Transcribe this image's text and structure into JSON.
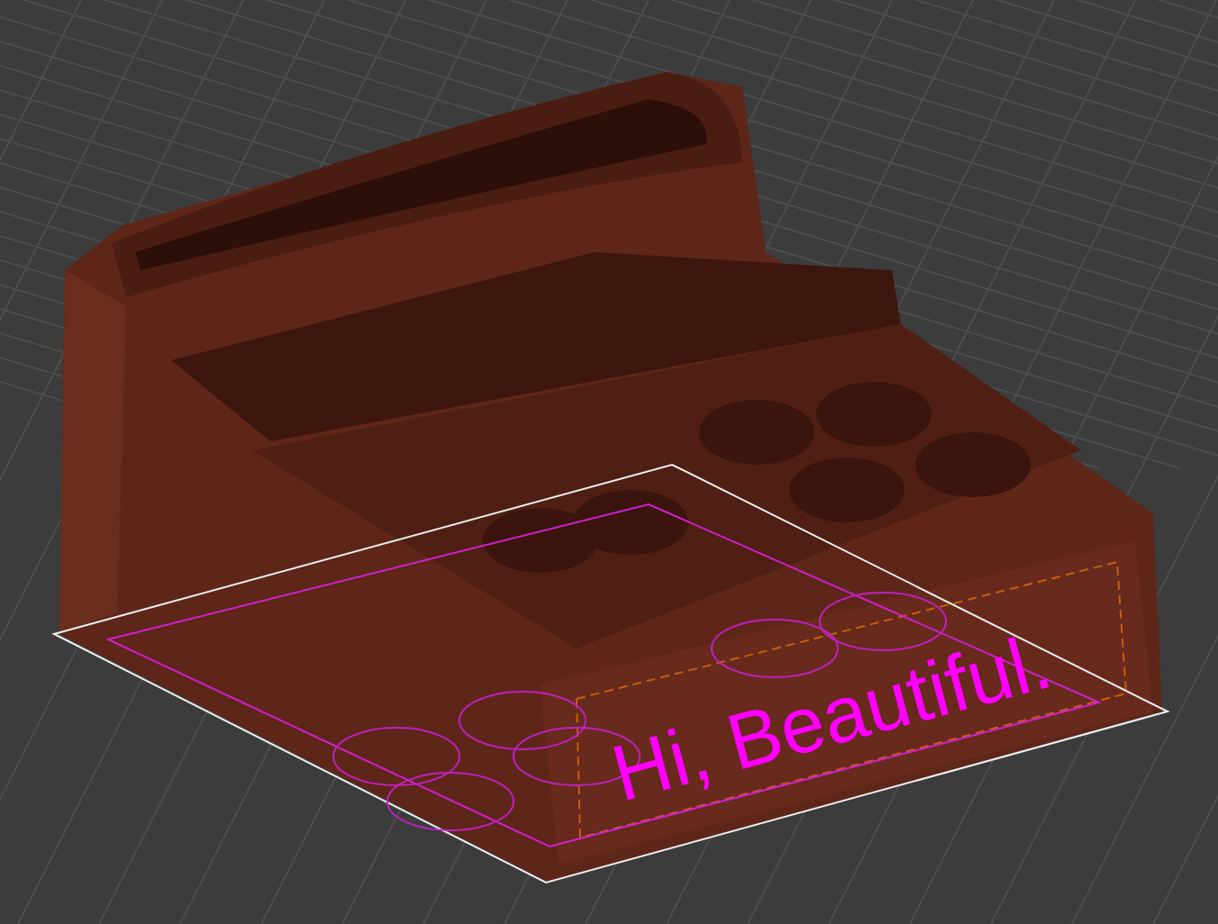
{
  "model_text": "Hi, Beautiful."
}
